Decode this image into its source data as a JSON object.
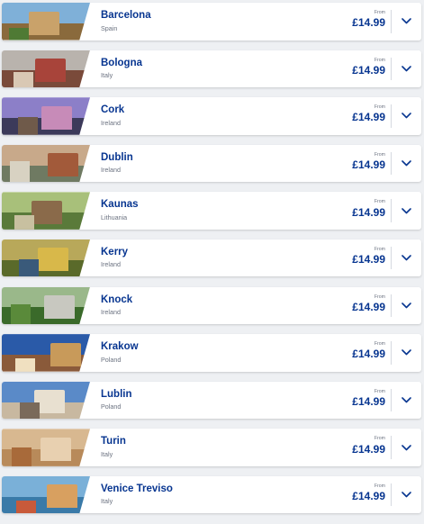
{
  "destinations": [
    {
      "city": "Barcelona",
      "country": "Spain",
      "from_label": "From",
      "price": "£14.99",
      "thumb": {
        "sky": "#7fb0d8",
        "ground": "#8a6a3c",
        "accent": "#c9a26a",
        "accent2": "#4f7a34"
      }
    },
    {
      "city": "Bologna",
      "country": "Italy",
      "from_label": "From",
      "price": "£14.99",
      "thumb": {
        "sky": "#b9b3ad",
        "ground": "#7a4a3a",
        "accent": "#a8443a",
        "accent2": "#d9c8b4"
      }
    },
    {
      "city": "Cork",
      "country": "Ireland",
      "from_label": "From",
      "price": "£14.99",
      "thumb": {
        "sky": "#8c7fc8",
        "ground": "#3c3a5a",
        "accent": "#c78bb8",
        "accent2": "#6f5a4a"
      }
    },
    {
      "city": "Dublin",
      "country": "Ireland",
      "from_label": "From",
      "price": "£14.99",
      "thumb": {
        "sky": "#c8a98a",
        "ground": "#6f7a62",
        "accent": "#a25a3a",
        "accent2": "#d8d2c2"
      }
    },
    {
      "city": "Kaunas",
      "country": "Lithuania",
      "from_label": "From",
      "price": "£14.99",
      "thumb": {
        "sky": "#a8c07a",
        "ground": "#5a7a3a",
        "accent": "#8a6a4a",
        "accent2": "#c8c0a0"
      }
    },
    {
      "city": "Kerry",
      "country": "Ireland",
      "from_label": "From",
      "price": "£14.99",
      "thumb": {
        "sky": "#b8a85a",
        "ground": "#5a6a2a",
        "accent": "#d8b84a",
        "accent2": "#3a5a7a"
      }
    },
    {
      "city": "Knock",
      "country": "Ireland",
      "from_label": "From",
      "price": "£14.99",
      "thumb": {
        "sky": "#9ab88a",
        "ground": "#3a6a2a",
        "accent": "#c8c8c0",
        "accent2": "#5a8a3a"
      }
    },
    {
      "city": "Krakow",
      "country": "Poland",
      "from_label": "From",
      "price": "£14.99",
      "thumb": {
        "sky": "#2a5aa8",
        "ground": "#8a5a3a",
        "accent": "#c89a5a",
        "accent2": "#f0e0c0"
      }
    },
    {
      "city": "Lublin",
      "country": "Poland",
      "from_label": "From",
      "price": "£14.99",
      "thumb": {
        "sky": "#5a8ac8",
        "ground": "#c8b8a0",
        "accent": "#e8e0d0",
        "accent2": "#7a6a5a"
      }
    },
    {
      "city": "Turin",
      "country": "Italy",
      "from_label": "From",
      "price": "£14.99",
      "thumb": {
        "sky": "#d8b890",
        "ground": "#b88a5a",
        "accent": "#e8d0b0",
        "accent2": "#a86a3a"
      }
    },
    {
      "city": "Venice Treviso",
      "country": "Italy",
      "from_label": "From",
      "price": "£14.99",
      "thumb": {
        "sky": "#7ab0d8",
        "ground": "#3a7aa8",
        "accent": "#d8a060",
        "accent2": "#c85a3a"
      }
    }
  ]
}
